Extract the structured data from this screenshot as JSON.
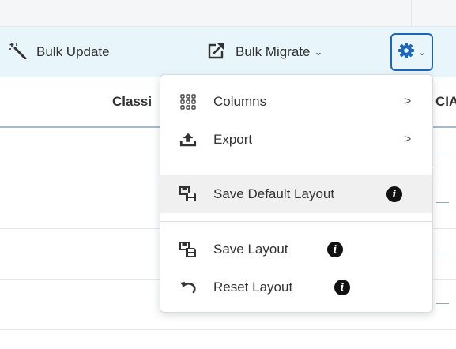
{
  "toolbar": {
    "bulk_update": "Bulk Update",
    "bulk_migrate": "Bulk Migrate",
    "chevron": "⌄"
  },
  "table": {
    "headers": [
      "Classi",
      "CIA"
    ],
    "empty_cell": "—"
  },
  "menu": {
    "items": [
      {
        "label": "Columns",
        "icon": "grid-icon",
        "submenu": true
      },
      {
        "label": "Export",
        "icon": "upload-icon",
        "submenu": true
      },
      {
        "label": "Save Default Layout",
        "icon": "save-icon",
        "info": true,
        "highlighted": true
      },
      {
        "label": "Save Layout",
        "icon": "save-icon",
        "info": true
      },
      {
        "label": "Reset Layout",
        "icon": "undo-icon",
        "info": true
      }
    ],
    "submenu_arrow": ">",
    "info_glyph": "i"
  },
  "colors": {
    "toolbar_bg": "#e8f6fb",
    "gear_blue": "#1d67b8",
    "highlight_bg": "#f0f0f0"
  }
}
